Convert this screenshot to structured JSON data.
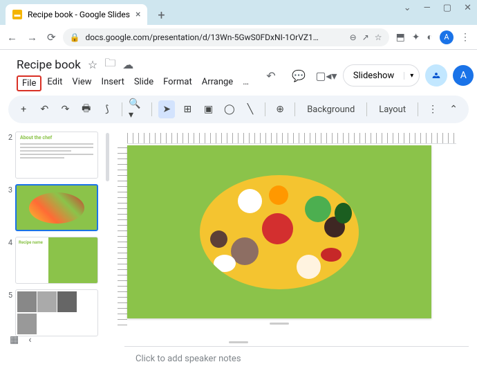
{
  "browser": {
    "tab_title": "Recipe book - Google Slides",
    "url": "docs.google.com/presentation/d/13Wn-5GwS0FDxNI-1OrVZ1…",
    "avatar_letter": "A"
  },
  "app": {
    "doc_title": "Recipe book",
    "menus": [
      "File",
      "Edit",
      "View",
      "Insert",
      "Slide",
      "Format",
      "Arrange",
      "…"
    ],
    "highlighted_menu": "File",
    "slideshow_label": "Slideshow",
    "avatar_letter": "A"
  },
  "toolbar": {
    "background_label": "Background",
    "layout_label": "Layout"
  },
  "thumbnails": [
    {
      "num": "2",
      "type": "text",
      "title": "About the chef"
    },
    {
      "num": "3",
      "type": "food",
      "selected": true
    },
    {
      "num": "4",
      "type": "recipe",
      "title": "Recipe name"
    },
    {
      "num": "5",
      "type": "photos"
    }
  ],
  "notes": {
    "placeholder": "Click to add speaker notes"
  }
}
